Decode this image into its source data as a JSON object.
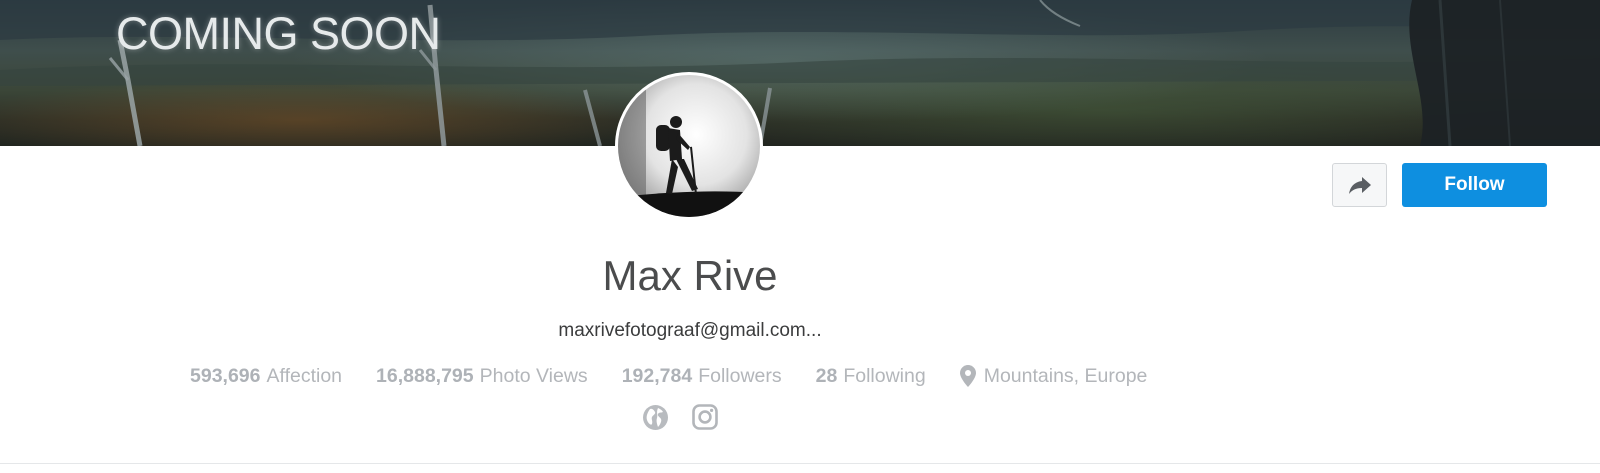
{
  "cover": {
    "overlay_text": "COMING SOON"
  },
  "profile": {
    "name": "Max Rive",
    "email": "maxrivefotograaf@gmail.com..."
  },
  "actions": {
    "share_icon": "share-arrow-icon",
    "follow_label": "Follow"
  },
  "stats": [
    {
      "value": "593,696",
      "label": "Affection"
    },
    {
      "value": "16,888,795",
      "label": "Photo Views"
    },
    {
      "value": "192,784",
      "label": "Followers"
    },
    {
      "value": "28",
      "label": "Following"
    }
  ],
  "location": {
    "icon": "location-pin-icon",
    "text": "Mountains, Europe"
  },
  "socials": [
    {
      "icon": "globe-icon"
    },
    {
      "icon": "instagram-icon"
    }
  ],
  "colors": {
    "follow_button": "#0e8fe0",
    "stat_text": "#b3b6ba",
    "name_text": "#4b4c4d"
  }
}
